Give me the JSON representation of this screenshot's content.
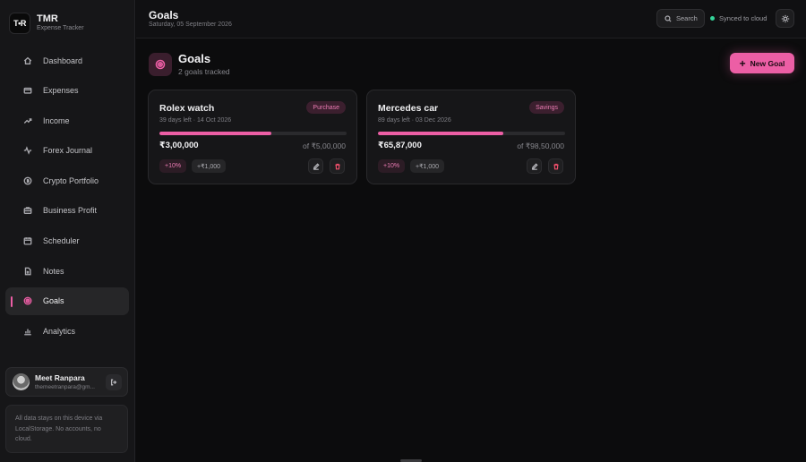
{
  "brand": {
    "logo_text": "T•R",
    "title": "TMR",
    "subtitle": "Expense Tracker"
  },
  "sidebar": {
    "items": [
      {
        "label": "Dashboard",
        "icon": "home-icon"
      },
      {
        "label": "Expenses",
        "icon": "card-icon"
      },
      {
        "label": "Income",
        "icon": "trend-up-icon"
      },
      {
        "label": "Forex Journal",
        "icon": "activity-icon"
      },
      {
        "label": "Crypto Portfolio",
        "icon": "coin-icon"
      },
      {
        "label": "Business Profit",
        "icon": "briefcase-icon"
      },
      {
        "label": "Scheduler",
        "icon": "calendar-icon"
      },
      {
        "label": "Notes",
        "icon": "document-icon"
      },
      {
        "label": "Goals",
        "icon": "target-icon",
        "active": true
      },
      {
        "label": "Analytics",
        "icon": "bar-chart-icon"
      }
    ],
    "user": {
      "name": "Meet Ranpara",
      "email": "themeetranpara@gm..."
    },
    "storage_note": "All data stays on this device via LocalStorage. No accounts, no cloud."
  },
  "header": {
    "title": "Goals",
    "date": "Saturday, 05 September 2026",
    "search_label": "Search",
    "sync_status": "Synced to cloud"
  },
  "main": {
    "title": "Goals",
    "subtitle": "2 goals tracked",
    "new_goal_label": "New Goal",
    "accent_color": "#ec5ea5",
    "goals": [
      {
        "name": "Rolex watch",
        "meta": "39 days left · 14 Oct 2026",
        "tag": "Purchase",
        "progress": 0.6,
        "current": "₹3,00,000",
        "target": "of ₹5,00,000",
        "chip1": "+10%",
        "chip2": "+₹1,000"
      },
      {
        "name": "Mercedes car",
        "meta": "89 days left · 03 Dec 2026",
        "tag": "Savings",
        "progress": 0.668,
        "current": "₹65,87,000",
        "target": "of ₹98,50,000",
        "chip1": "+10%",
        "chip2": "+₹1,000"
      }
    ]
  }
}
